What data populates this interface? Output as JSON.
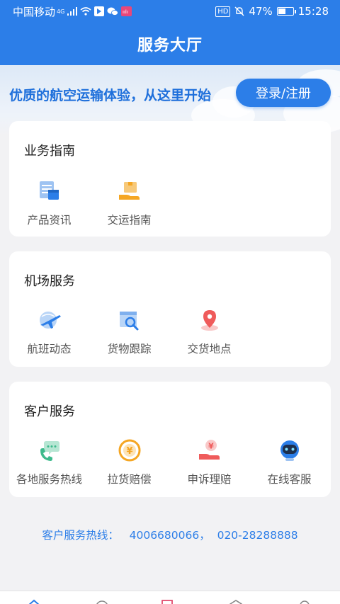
{
  "status_bar": {
    "carrier": "中国移动",
    "network": "4G",
    "battery": "47%",
    "battery_level": 0.47,
    "time": "15:28",
    "hd": "HD"
  },
  "header": {
    "title": "服务大厅"
  },
  "banner": {
    "tagline": "优质的航空运输体验，从这里开始",
    "login_label": "登录/注册"
  },
  "sections": [
    {
      "title": "业务指南",
      "items": [
        {
          "label": "产品资讯",
          "icon": "product-info-icon"
        },
        {
          "label": "交运指南",
          "icon": "shipping-guide-icon"
        }
      ]
    },
    {
      "title": "机场服务",
      "items": [
        {
          "label": "航班动态",
          "icon": "flight-status-icon"
        },
        {
          "label": "货物跟踪",
          "icon": "cargo-tracking-icon"
        },
        {
          "label": "交货地点",
          "icon": "location-pin-icon"
        }
      ]
    },
    {
      "title": "客户服务",
      "items": [
        {
          "label": "各地服务热线",
          "icon": "phone-chat-icon"
        },
        {
          "label": "拉货赔偿",
          "icon": "yuan-coin-icon"
        },
        {
          "label": "申诉理赔",
          "icon": "hand-money-icon"
        },
        {
          "label": "在线客服",
          "icon": "robot-icon"
        }
      ]
    }
  ],
  "hotline": {
    "text": "客户服务热线：   4006680066，  020-28288888"
  },
  "colors": {
    "primary": "#2c7ee8",
    "orange": "#f5a623",
    "red": "#ef5b5b",
    "green": "#3dba8c"
  }
}
